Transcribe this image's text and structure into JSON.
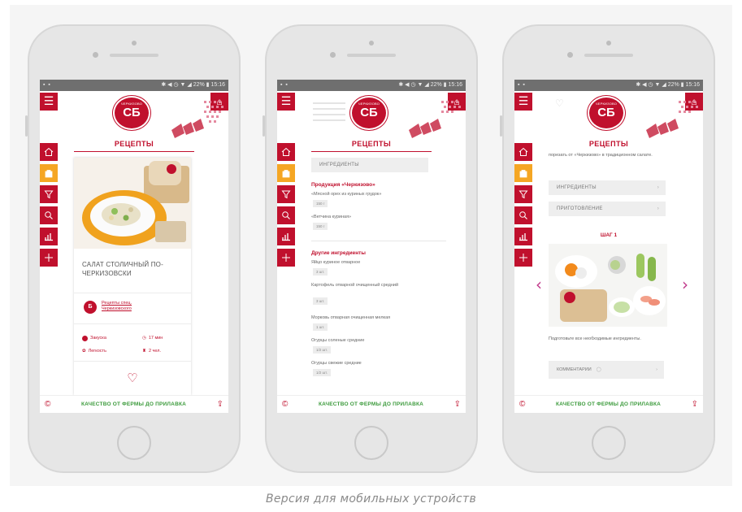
{
  "caption": "Версия для мобильных устройств",
  "colors": {
    "brand_red": "#c0102d",
    "active_orange": "#f5a623",
    "slogan_green": "#3d9b3d",
    "chevron_purple": "#c13a8b"
  },
  "status_bar": {
    "left": "▪ ▪",
    "right": "✱ ◀ ◷ ▼ ◢ 22% ▮ 15:16"
  },
  "logo": {
    "text": "ЧЕРКИЗОВО",
    "mark": "CƂ"
  },
  "page_title": "РЕЦЕПТЫ",
  "bottom_bar": {
    "slogan": "КАЧЕСТВО ОТ ФЕРМЫ ДО ПРИЛАВКА"
  },
  "sidebar_icons": [
    "home-icon",
    "bag-icon",
    "filter-icon",
    "search-icon",
    "chart-icon",
    "plus-icon"
  ],
  "phone1": {
    "card_title": "САЛАТ СТОЛИЧНЫЙ ПО-ЧЕРКИЗОВСКИ",
    "brand_link": "Рецепты спец. Черкизовского",
    "meta": {
      "type_label": "Закуска",
      "time_label": "17 мин",
      "difficulty_label": "Легкость",
      "persons_label": "2 чел."
    }
  },
  "phone2": {
    "ingredients_button": "ИНГРЕДИЕНТЫ",
    "products_title": "Продукция «Черкизово»",
    "products": [
      {
        "name": "«Мясной орех из куриных грудок»",
        "qty": "150 г"
      },
      {
        "name": "«Ветчина куриная»",
        "qty": "150 г"
      }
    ],
    "other_title": "Другие ингредиенты",
    "others": [
      {
        "name": "Яйцо куриное отварное",
        "qty": "3 шт."
      },
      {
        "name": "Картофель отварной очищенный средний",
        "qty": "3 шт."
      },
      {
        "name": "Морковь отварная очищенная мелкая",
        "qty": "1 шт."
      },
      {
        "name": "Огурцы соленые средние",
        "qty": "1/2 шт."
      },
      {
        "name": "Огурцы свежие средние",
        "qty": "1/2 шт."
      }
    ]
  },
  "phone3": {
    "intro": "порезать от «Черкизово» в традиционном салате.",
    "ingredients_button": "ИНГРЕДИЕНТЫ",
    "cooking_button": "ПРИГОТОВЛЕНИЕ",
    "step_title": "ШАГ 1",
    "step_desc": "Подготовьте все необходимые ингредиенты.",
    "comments_button": "КОММЕНТАРИИ"
  }
}
